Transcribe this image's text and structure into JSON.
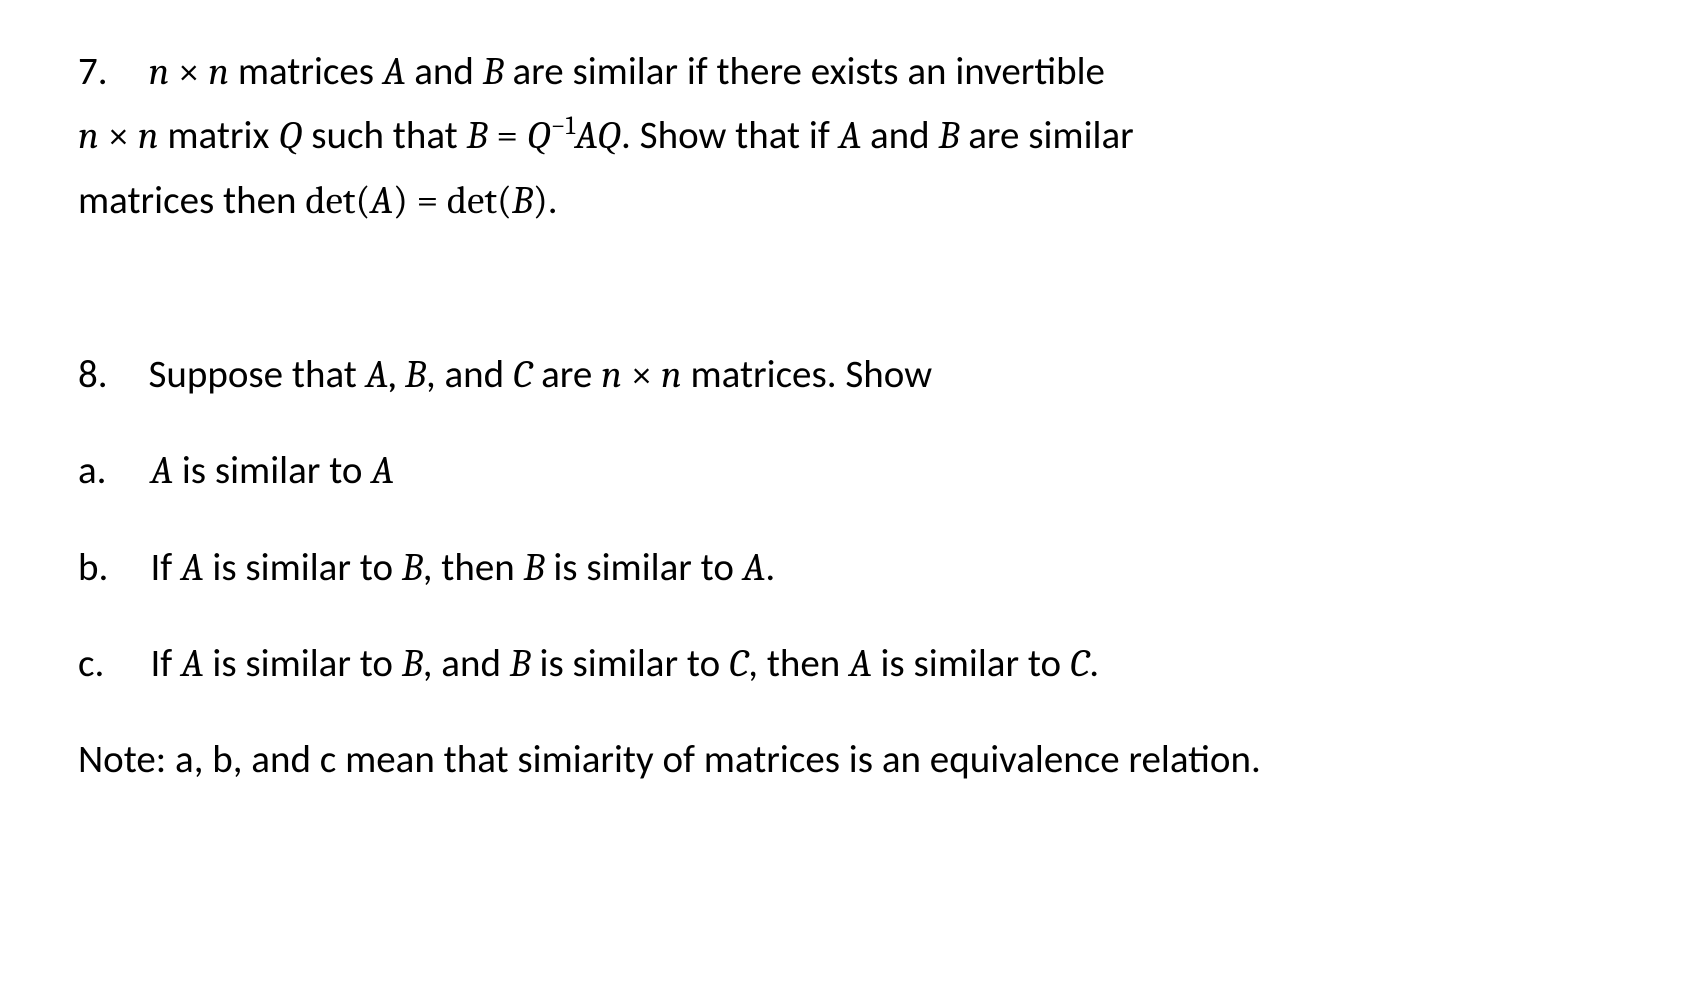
{
  "p7": {
    "num": "7.",
    "t1a": "matrices",
    "t1b": "and",
    "t1c": "are similar if there exists an invertible",
    "t2a": "matrix",
    "t2b": "such that",
    "t2c": ".  Show that if",
    "t2d": "and",
    "t2e": "are similar",
    "t3a": "matrices then",
    "t3b": "."
  },
  "p8": {
    "num": "8.",
    "t1a": "Suppose that",
    "t1b": ", and",
    "t1c": "are",
    "t1d": "matrices.  Show",
    "a_lbl": "a.",
    "a_t1": "is similar to",
    "b_lbl": "b.",
    "b_t1": "If",
    "b_t2": "is similar to",
    "b_t3": ", then",
    "b_t4": "is similar to",
    "b_t5": ".",
    "c_lbl": "c.",
    "c_t1": "If ",
    "c_t2": "is similar to",
    "c_t3": ", and",
    "c_t4": "is similar to",
    "c_t5": ", then",
    "c_t6": "is similar to",
    "c_t7": ".",
    "note": "Note:  a, b, and c mean that simiarity of matrices is an equivalence relation."
  },
  "sym": {
    "n": "n",
    "A": "A",
    "B": "B",
    "C": "C",
    "Q": "Q",
    "times": "×",
    "eq": "=",
    "inv": "−1",
    "det": "det",
    "lp": "(",
    "rp": ")",
    "comma": ","
  }
}
